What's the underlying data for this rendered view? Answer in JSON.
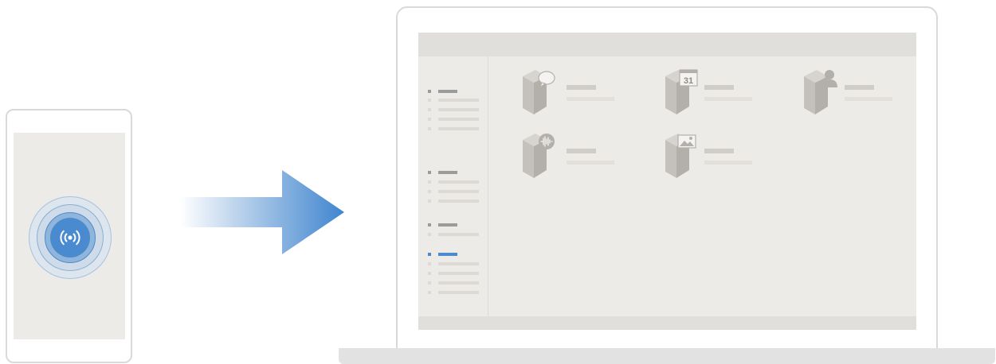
{
  "colors": {
    "accent": "#4a8bd0",
    "screen_bg": "#edebe8",
    "device_outline": "#d9d9d9"
  },
  "phone": {
    "icon": "nfc-signal-icon"
  },
  "transfer_arrow": {
    "icon": "right-arrow-icon",
    "gradient_start": "#ffffff",
    "gradient_end": "#3f85cf"
  },
  "laptop": {
    "sidebar_groups": [
      {
        "header_icon": "dash-placeholder",
        "sub_item_count": 4
      },
      {
        "header_icon": "dash-placeholder",
        "sub_item_count": 3
      },
      {
        "header_icon": "dash-placeholder",
        "sub_item_count": 1
      },
      {
        "header_icon": "dash-placeholder",
        "sub_item_count": 4,
        "active": true
      }
    ],
    "folders": [
      {
        "icon": "messages-folder-icon"
      },
      {
        "icon": "calendar-folder-icon",
        "badge": "31"
      },
      {
        "icon": "contacts-folder-icon"
      },
      {
        "icon": "audio-folder-icon"
      },
      {
        "icon": "gallery-folder-icon"
      }
    ]
  }
}
